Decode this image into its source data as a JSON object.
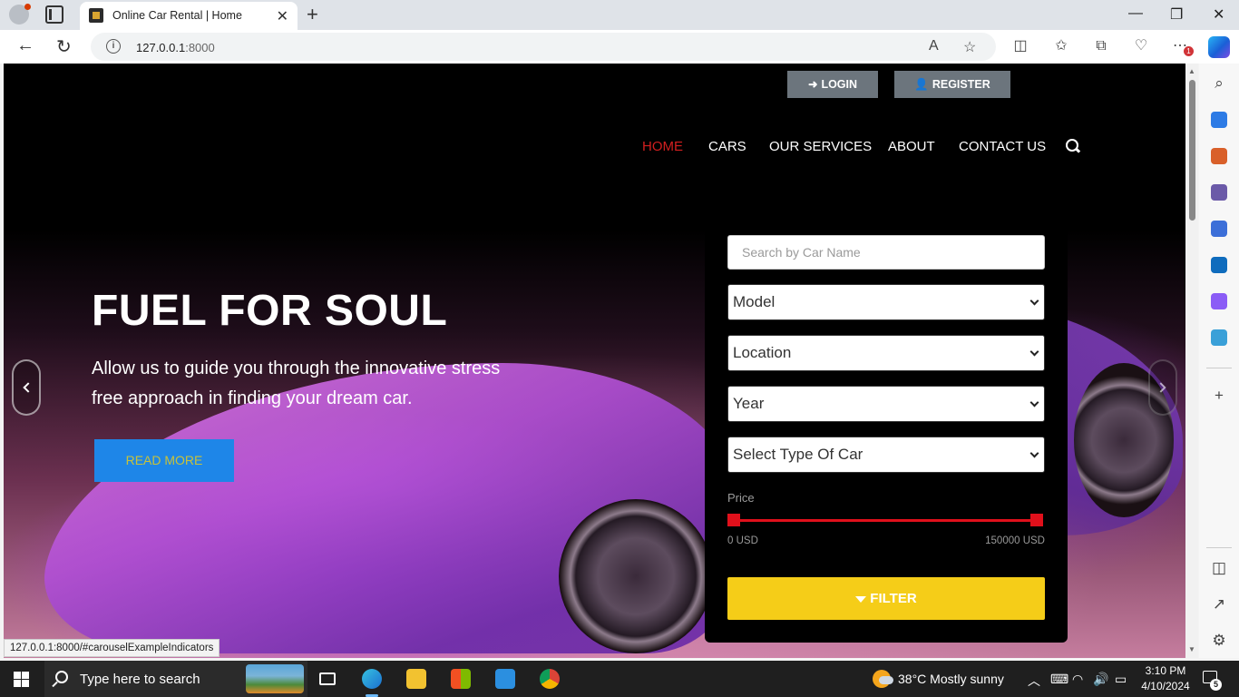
{
  "browser": {
    "tab_title": "Online Car Rental | Home",
    "url_host": "127.0.0.1",
    "url_port": ":8000",
    "notification_badge": "1"
  },
  "header": {
    "login_label": "LOGIN",
    "register_label": "REGISTER",
    "menu": [
      {
        "label": "HOME",
        "active": true
      },
      {
        "label": "CARS"
      },
      {
        "label": "OUR SERVICES"
      },
      {
        "label": "ABOUT"
      },
      {
        "label": "CONTACT US"
      }
    ]
  },
  "hero": {
    "title": "FUEL FOR SOUL",
    "subtitle": "Allow us to guide you through the innovative stress free approach in finding your dream car.",
    "read_more": "READ MORE"
  },
  "filter": {
    "search_placeholder": "Search by Car Name",
    "model": "Model",
    "location": "Location",
    "year": "Year",
    "car_type": "Select Type Of Car",
    "price_label": "Price",
    "price_min": "0 USD",
    "price_max": "150000 USD",
    "filter_button": "FILTER"
  },
  "status_bar_url": "127.0.0.1:8000/#carouselExampleIndicators",
  "taskbar": {
    "search_placeholder": "Type here to search",
    "weather": "38°C  Mostly sunny",
    "time": "3:10 PM",
    "date": "4/10/2024",
    "notification_count": "5"
  },
  "colors": {
    "accent_red": "#d21f1f",
    "read_more_bg": "#1e86e8",
    "filter_button_bg": "#f5cd18",
    "range_red": "#e0101b"
  }
}
